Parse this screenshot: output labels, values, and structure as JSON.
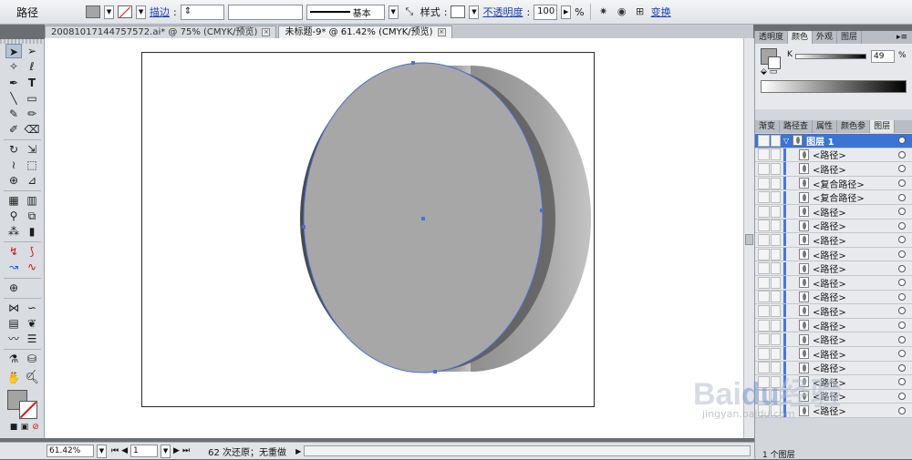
{
  "control_bar": {
    "object_type": "路径",
    "stroke_label": "描边",
    "stroke_profile": "基本",
    "style_label": "样式",
    "opacity_label": "不透明度",
    "opacity_value": "100",
    "opacity_unit": "%",
    "transform_label": "变换"
  },
  "tabs": [
    {
      "label": "20081017144757572.ai* @ 75% (CMYK/预览)"
    },
    {
      "label": "未标题-9* @ 61.42% (CMYK/预览)"
    }
  ],
  "colors": {
    "fill": "#a5a5a5",
    "accent": "#3b74d2",
    "selection": "#4a6fd6"
  },
  "color_panel": {
    "tabs": [
      "透明度",
      "颜色",
      "外观",
      "图层"
    ],
    "k_label": "K",
    "k_value": "49",
    "k_unit": "%"
  },
  "layers_panel": {
    "tabs": [
      "渐变",
      "路径查",
      "属性",
      "颜色参",
      "图层"
    ],
    "layer_name": "图层 1",
    "items": [
      "<路径>",
      "<路径>",
      "<复合路径>",
      "<复合路径>",
      "<路径>",
      "<路径>",
      "<路径>",
      "<路径>",
      "<路径>",
      "<路径>",
      "<路径>",
      "<路径>",
      "<路径>",
      "<路径>",
      "<路径>",
      "<路径>",
      "<路径>",
      "<路径>",
      "<路径>"
    ],
    "status": "1 个图层"
  },
  "status_bar": {
    "zoom": "61.42%",
    "page": "1",
    "history": "62 次还原；无重做"
  },
  "watermark": {
    "text": "Bai du 经验",
    "url": "jingyan.baidu.com"
  }
}
